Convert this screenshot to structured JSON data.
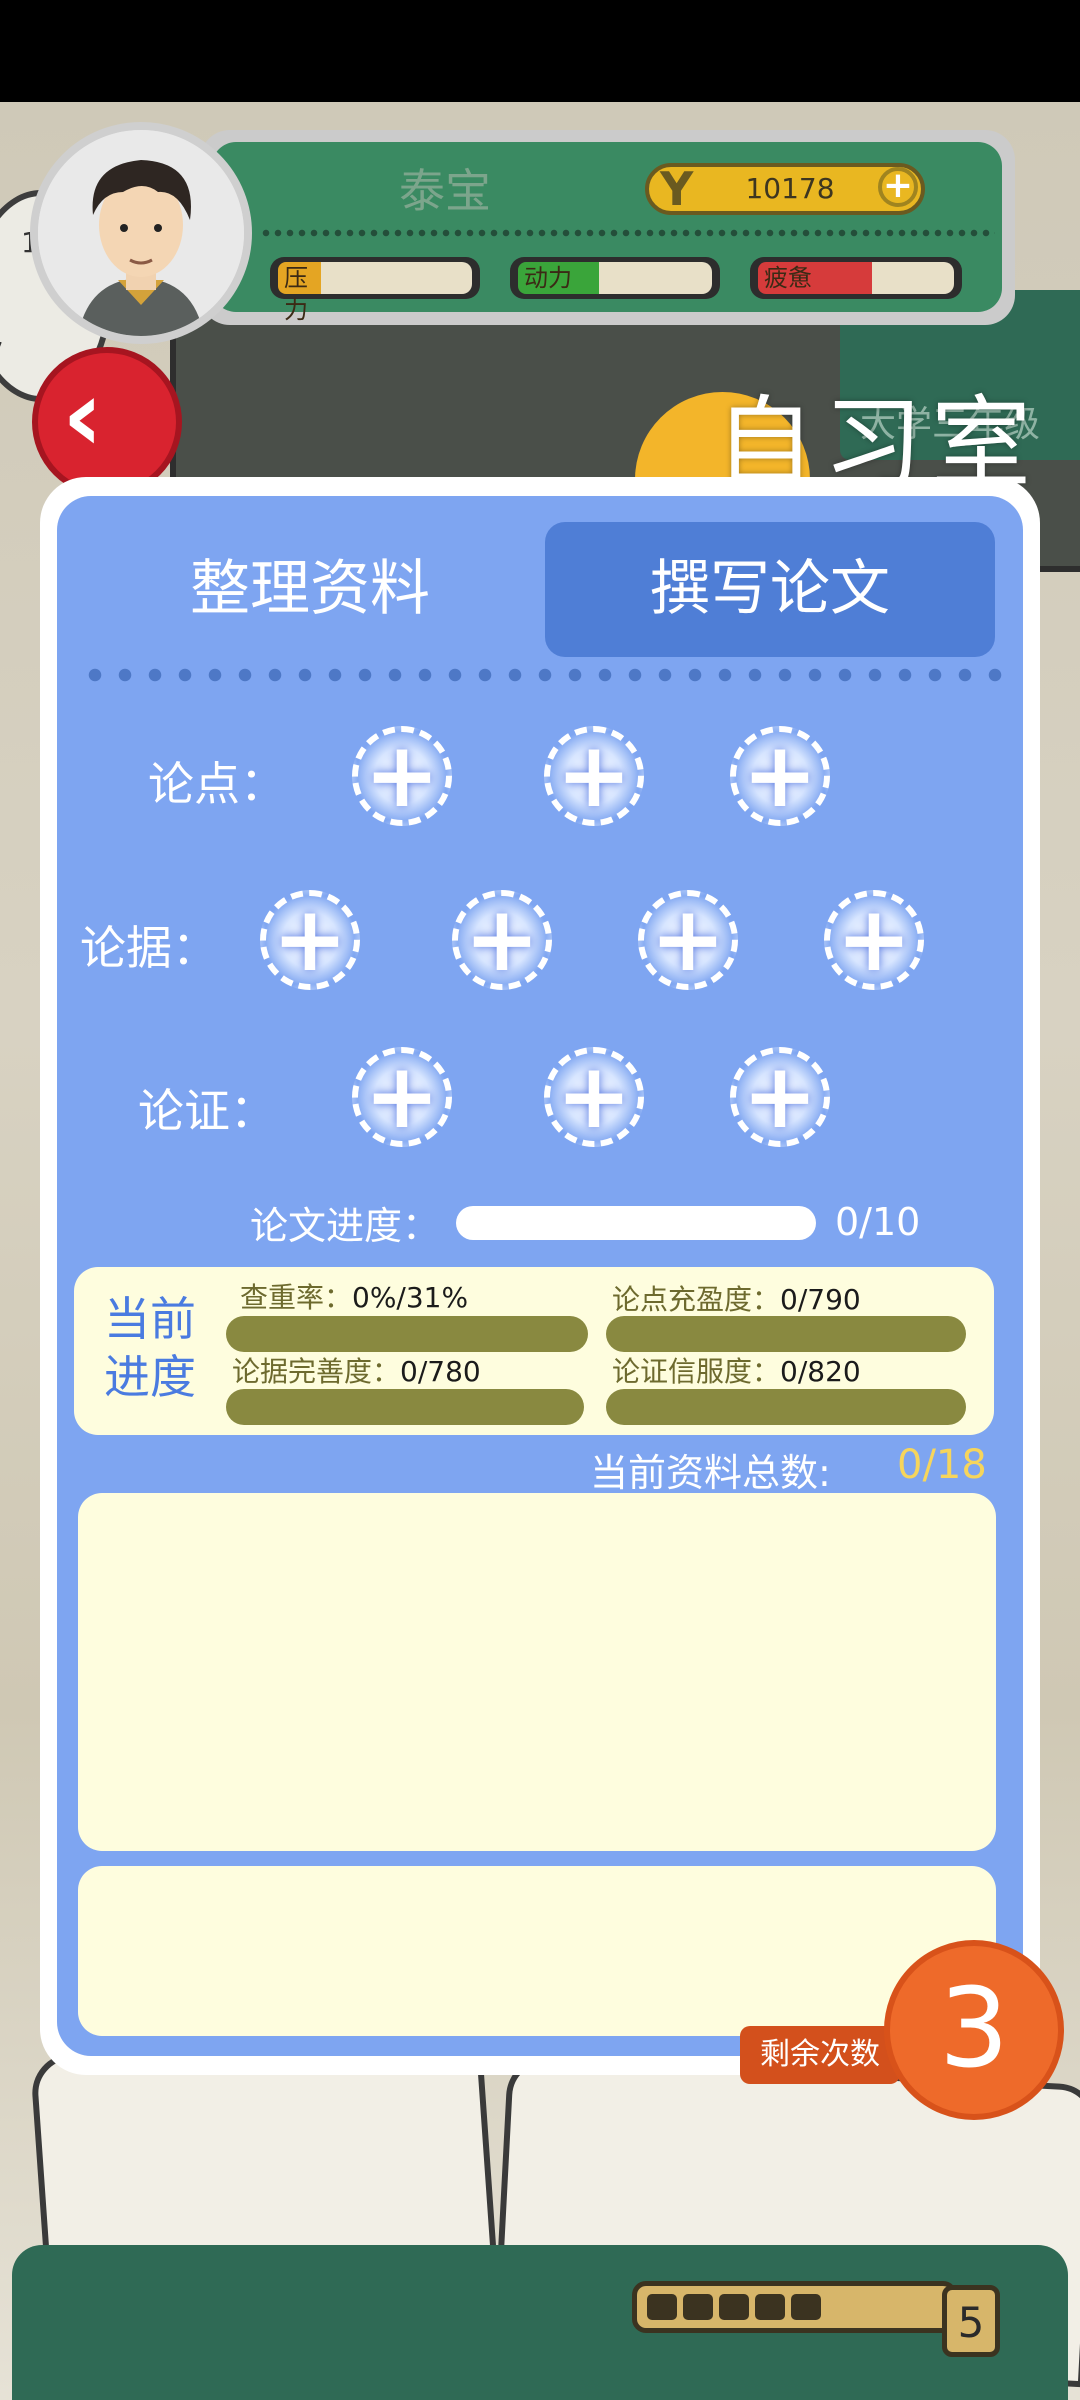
{
  "player": {
    "name": "泰宝",
    "coins": "10178",
    "coin_symbol": "Y",
    "coin_add": "+",
    "stats": [
      {
        "label": "压力",
        "fill": 0.22,
        "color": "#e4a523"
      },
      {
        "label": "动力",
        "fill": 0.42,
        "color": "#3aa53a"
      },
      {
        "label": "疲惫",
        "fill": 0.58,
        "color": "#d63b3b"
      }
    ]
  },
  "nav": {
    "back_icon": "‹"
  },
  "page": {
    "title": "自习室",
    "background_sign": "大学三年级"
  },
  "tabs": [
    {
      "label": "整理资料",
      "active": false
    },
    {
      "label": "撰写论文",
      "active": true
    }
  ],
  "slots": {
    "plus": "+",
    "rows": [
      {
        "label": "论点：",
        "count": 3
      },
      {
        "label": "论据：",
        "count": 4
      },
      {
        "label": "论证：",
        "count": 3
      }
    ]
  },
  "progress": {
    "label": "论文进度：",
    "value": "0/10",
    "fraction": 0
  },
  "current": {
    "label_line1": "当前",
    "label_line2": "进度",
    "items": [
      {
        "label": "查重率：",
        "value": "0%/31%"
      },
      {
        "label": "论点充盈度：",
        "value": "0/790"
      },
      {
        "label": "论据完善度：",
        "value": "0/780"
      },
      {
        "label": "论证信服度：",
        "value": "0/820"
      }
    ]
  },
  "materials": {
    "label": "当前资料总数:",
    "value": "0/18"
  },
  "remaining": {
    "label": "剩余次数",
    "value": "3"
  },
  "dice": {
    "value": "5",
    "filled": 5
  }
}
